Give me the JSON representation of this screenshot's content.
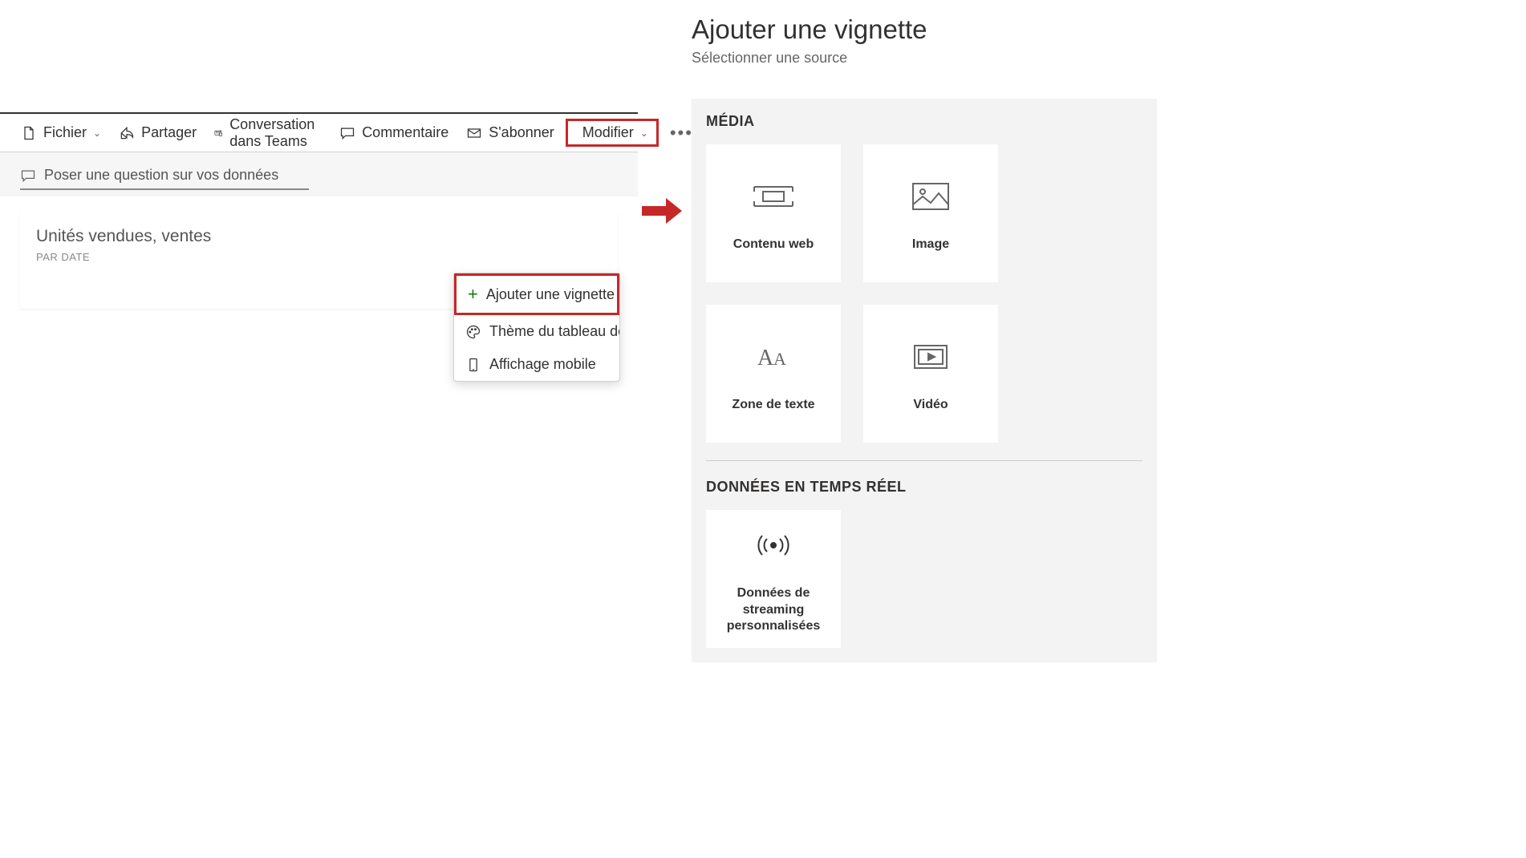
{
  "toolbar": {
    "file": "Fichier",
    "share": "Partager",
    "teams": "Conversation dans Teams",
    "comment": "Commentaire",
    "subscribe": "S'abonner",
    "modify": "Modifier"
  },
  "question": {
    "placeholder": "Poser une question sur vos données"
  },
  "card": {
    "title": "Unités vendues, ventes",
    "subtitle": "PAR DATE"
  },
  "dropdown": {
    "add_tile": "Ajouter une vignette",
    "theme": "Thème du tableau de..",
    "mobile": "Affichage mobile"
  },
  "panel": {
    "title": "Ajouter une vignette",
    "subtitle": "Sélectionner une source",
    "media_header": "MÉDIA",
    "realtime_header": "DONNÉES EN TEMPS RÉEL",
    "tiles": {
      "web": "Contenu web",
      "image": "Image",
      "textzone": "Zone de texte",
      "video": "Vidéo",
      "streaming": "Données de streaming personnalisées"
    }
  }
}
